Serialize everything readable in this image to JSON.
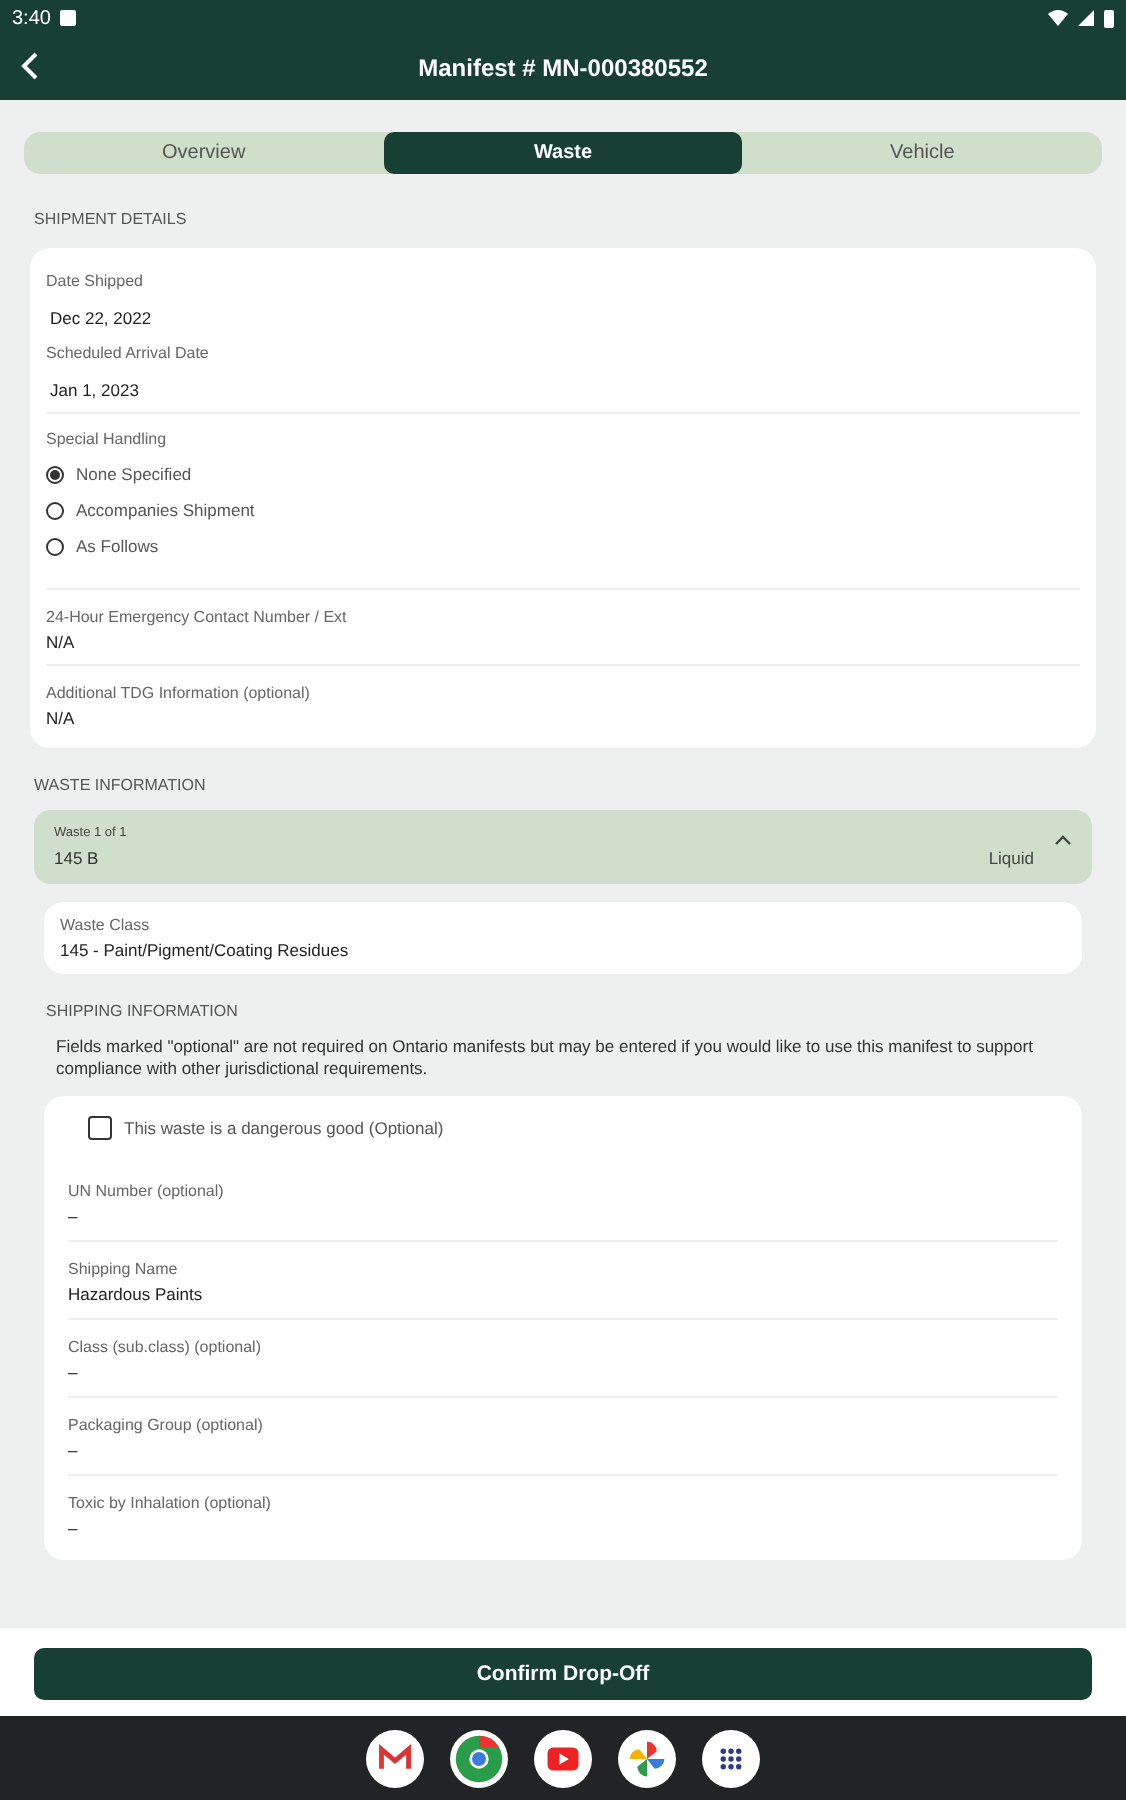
{
  "status_bar": {
    "time": "3:40"
  },
  "app_bar": {
    "title": "Manifest # MN-000380552"
  },
  "tabs": [
    {
      "label": "Overview",
      "selected": false
    },
    {
      "label": "Waste",
      "selected": true
    },
    {
      "label": "Vehicle",
      "selected": false
    }
  ],
  "shipment_details": {
    "heading": "SHIPMENT DETAILS",
    "dates": [
      {
        "label": "Date Shipped",
        "value": "Dec 22, 2022"
      },
      {
        "label": "Scheduled Arrival Date",
        "value": "Jan 1, 2023"
      }
    ],
    "special_handling": {
      "label": "Special Handling",
      "options": [
        {
          "label": "None Specified",
          "selected": true
        },
        {
          "label": "Accompanies Shipment",
          "selected": false
        },
        {
          "label": "As Follows",
          "selected": false
        }
      ]
    },
    "fields": [
      {
        "label": "24-Hour Emergency Contact Number / Ext",
        "value": "N/A"
      },
      {
        "label": "Additional TDG Information (optional)",
        "value": "N/A"
      }
    ]
  },
  "waste_information": {
    "heading": "WASTE INFORMATION",
    "waste": {
      "caption": "Waste 1 of 1",
      "code": "145 B",
      "state": "Liquid",
      "expanded": true
    },
    "waste_class": {
      "label": "Waste Class",
      "value": "145 - Paint/Pigment/Coating Residues"
    }
  },
  "shipping_information": {
    "heading": "SHIPPING INFORMATION",
    "note": "Fields marked \"optional\" are not required on Ontario manifests but may be entered if you would like to use this manifest to support compliance with other jurisdictional requirements.",
    "dangerous_good": {
      "label": "This waste is a dangerous good (Optional)",
      "checked": false
    },
    "fields": [
      {
        "label": "UN Number (optional)",
        "value": "–"
      },
      {
        "label": "Shipping Name",
        "value": "Hazardous Paints"
      },
      {
        "label": "Class (sub.class) (optional)",
        "value": "–"
      },
      {
        "label": "Packaging Group (optional)",
        "value": "–"
      },
      {
        "label": "Toxic by Inhalation (optional)",
        "value": "–"
      }
    ]
  },
  "confirm_button": "Confirm Drop-Off"
}
